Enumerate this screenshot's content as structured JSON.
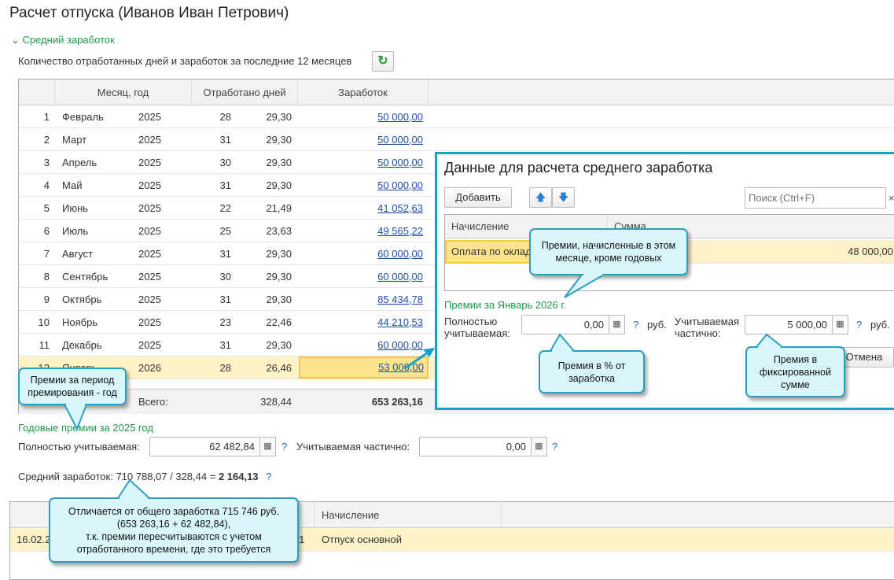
{
  "title": "Расчет отпуска (Иванов Иван Петрович)",
  "section": "Средний заработок",
  "subtitle": "Количество отработанных дней и заработок за последние 12 месяцев",
  "table": {
    "headers": [
      "Месяц, год",
      "Отработано дней",
      "Заработок"
    ],
    "rows": [
      {
        "n": "1",
        "month": "Февраль",
        "year": "2025",
        "days": "28",
        "calc_days": "29,30",
        "earn": "50 000,00"
      },
      {
        "n": "2",
        "month": "Март",
        "year": "2025",
        "days": "31",
        "calc_days": "29,30",
        "earn": "50 000,00"
      },
      {
        "n": "3",
        "month": "Апрель",
        "year": "2025",
        "days": "30",
        "calc_days": "29,30",
        "earn": "50 000,00"
      },
      {
        "n": "4",
        "month": "Май",
        "year": "2025",
        "days": "31",
        "calc_days": "29,30",
        "earn": "50 000,00"
      },
      {
        "n": "5",
        "month": "Июнь",
        "year": "2025",
        "days": "22",
        "calc_days": "21,49",
        "earn": "41 052,63"
      },
      {
        "n": "6",
        "month": "Июль",
        "year": "2025",
        "days": "25",
        "calc_days": "23,63",
        "earn": "49 565,22"
      },
      {
        "n": "7",
        "month": "Август",
        "year": "2025",
        "days": "31",
        "calc_days": "29,30",
        "earn": "60 000,00"
      },
      {
        "n": "8",
        "month": "Сентябрь",
        "year": "2025",
        "days": "30",
        "calc_days": "29,30",
        "earn": "60 000,00"
      },
      {
        "n": "9",
        "month": "Октябрь",
        "year": "2025",
        "days": "31",
        "calc_days": "29,30",
        "earn": "85 434,78"
      },
      {
        "n": "10",
        "month": "Ноябрь",
        "year": "2025",
        "days": "23",
        "calc_days": "22,46",
        "earn": "44 210,53"
      },
      {
        "n": "11",
        "month": "Декабрь",
        "year": "2025",
        "days": "31",
        "calc_days": "29,30",
        "earn": "60 000,00"
      },
      {
        "n": "12",
        "month": "Январь",
        "year": "2026",
        "days": "28",
        "calc_days": "26,46",
        "earn": "53 000,00"
      }
    ],
    "total_label": "Всего:",
    "total_days": "328,44",
    "total_earn": "653 263,16"
  },
  "annual": {
    "title": "Годовые премии за 2025 год",
    "full_label": "Полностью учитываемая:",
    "full_value": "62 482,84",
    "part_label": "Учитываемая частично:",
    "part_value": "0,00",
    "help": "?"
  },
  "average": {
    "prefix": "Средний заработок: 710 788,07 / 328,44 = ",
    "result": "2 164,13"
  },
  "bottom": {
    "col": "Начисление",
    "date": "16.02.2",
    "num": "91",
    "accrual": "Отпуск основной"
  },
  "dialog": {
    "title": "Данные для расчета среднего заработка",
    "add": "Добавить",
    "search_placeholder": "Поиск (Ctrl+F)",
    "clear": "×",
    "headers": [
      "Начисление",
      "Сумма"
    ],
    "row": {
      "accrual": "Оплата по окладу",
      "sum": "48 000,00"
    },
    "bonus_title": "Премии за Январь 2026 г.",
    "full_label": "Полностью учитываемая:",
    "full_value": "0,00",
    "part_label": "Учитываемая частично:",
    "part_value": "5 000,00",
    "unit": "руб.",
    "cancel": "Отмена"
  },
  "callouts": {
    "c1": "Премии за период премирования - год",
    "c2": "Премии, начисленные в этом месяце, кроме годовых",
    "c3": "Премия в % от заработка",
    "c4": "Премия в фиксированной сумме",
    "c5a": "Отличается от общего заработка 715 746 руб.",
    "c5b": "(653 263,16 + 62 482,84),",
    "c5c": "т.к. премии пересчитываются с учетом",
    "c5d": "отработанного времени, где это требуется"
  },
  "colors": {
    "accent_green": "#1a9a4a",
    "link": "#1d4fa8",
    "callout_border": "#2b9fc0",
    "dialog_border": "#15a2c2",
    "selected_row": "#fdf2c8"
  }
}
